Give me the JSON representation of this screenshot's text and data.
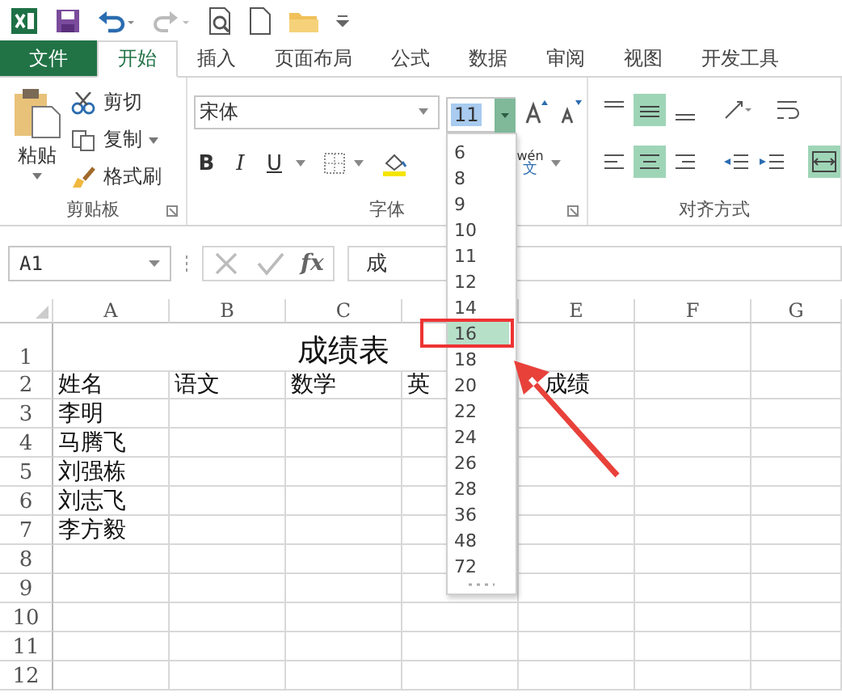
{
  "tabs": [
    {
      "label": "文件",
      "kind": "file",
      "selected": false
    },
    {
      "label": "开始",
      "kind": "tab",
      "selected": true
    },
    {
      "label": "插入",
      "kind": "tab",
      "selected": false
    },
    {
      "label": "页面布局",
      "kind": "tab",
      "selected": false
    },
    {
      "label": "公式",
      "kind": "tab",
      "selected": false
    },
    {
      "label": "数据",
      "kind": "tab",
      "selected": false
    },
    {
      "label": "审阅",
      "kind": "tab",
      "selected": false
    },
    {
      "label": "视图",
      "kind": "tab",
      "selected": false
    },
    {
      "label": "开发工具",
      "kind": "tab",
      "selected": false
    }
  ],
  "clipboard": {
    "paste": "粘贴",
    "items": [
      "剪切",
      "复制",
      "格式刷"
    ],
    "label": "剪贴板"
  },
  "font": {
    "font_name": "宋体",
    "font_size": "11",
    "buttons": [
      "B",
      "I",
      "U"
    ],
    "phonetic": "wén",
    "phonetic_char": "文",
    "label": "字体"
  },
  "alignment": {
    "label": "对齐方式"
  },
  "formula_bar": {
    "name_box": "A1",
    "fx": "fx",
    "content": "成"
  },
  "sheet": {
    "columns_left": [
      "A",
      "B",
      "C"
    ],
    "columns_right": [
      "E",
      "F",
      "G"
    ],
    "title": "成绩表",
    "rows": [
      {
        "number": "1"
      },
      {
        "number": "2",
        "cells": [
          "姓名",
          "语文",
          "数学",
          "英",
          "成绩"
        ]
      },
      {
        "number": "3",
        "cells": [
          "李明"
        ]
      },
      {
        "number": "4",
        "cells": [
          "马腾飞"
        ]
      },
      {
        "number": "5",
        "cells": [
          "刘强栋"
        ]
      },
      {
        "number": "6",
        "cells": [
          "刘志飞"
        ]
      },
      {
        "number": "7",
        "cells": [
          "李方毅"
        ]
      },
      {
        "number": "8"
      },
      {
        "number": "9"
      },
      {
        "number": "10"
      },
      {
        "number": "11"
      },
      {
        "number": "12"
      }
    ]
  },
  "size_dropdown": {
    "options": [
      {
        "label": "6",
        "selected": false
      },
      {
        "label": "8",
        "selected": false
      },
      {
        "label": "9",
        "selected": false
      },
      {
        "label": "10",
        "selected": false
      },
      {
        "label": "11",
        "selected": false
      },
      {
        "label": "12",
        "selected": false
      },
      {
        "label": "14",
        "selected": false
      },
      {
        "label": "16",
        "selected": true
      },
      {
        "label": "18",
        "selected": false
      },
      {
        "label": "20",
        "selected": false
      },
      {
        "label": "22",
        "selected": false
      },
      {
        "label": "24",
        "selected": false
      },
      {
        "label": "26",
        "selected": false
      },
      {
        "label": "28",
        "selected": false
      },
      {
        "label": "36",
        "selected": false
      },
      {
        "label": "48",
        "selected": false
      },
      {
        "label": "72",
        "selected": false
      }
    ]
  }
}
